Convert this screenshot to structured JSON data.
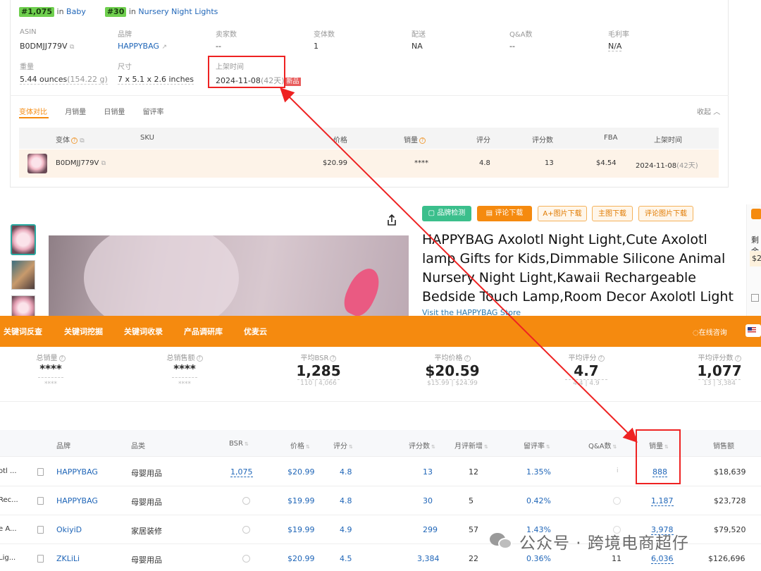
{
  "rank_bar": {
    "rank1": "#1,075",
    "in1": "in",
    "cat1": "Baby",
    "rank2": "#30",
    "in2": "in",
    "cat2": "Nursery Night Lights"
  },
  "product_info": {
    "asin_label": "ASIN",
    "asin": "B0DMJJ779V",
    "brand_label": "品牌",
    "brand": "HAPPYBAG",
    "seller_label": "卖家数",
    "seller": "--",
    "variant_label": "变体数",
    "variant": "1",
    "delivery_label": "配送",
    "delivery": "NA",
    "qa_label": "Q&A数",
    "qa": "--",
    "margin_label": "毛利率",
    "margin": "N/A",
    "weight_label": "重量",
    "weight": "5.44 ounces",
    "weight_g": "(154.22 g)",
    "size_label": "尺寸",
    "size": "7 x 5.1 x 2.6 inches",
    "listed_label": "上架时间",
    "listed": "2024-11-08",
    "listed_days": "(42天)",
    "new_badge": "新品"
  },
  "variant_tabs": {
    "tabs": [
      "变体对比",
      "月销量",
      "日销量",
      "留评率"
    ],
    "collapse": "收起"
  },
  "variant_table": {
    "headers": [
      "变体",
      "SKU",
      "价格",
      "销量",
      "评分",
      "评分数",
      "FBA",
      "上架时间"
    ],
    "row": {
      "asin": "B0DMJJ779V",
      "sku": "",
      "price": "$20.99",
      "sales": "****",
      "rating": "4.8",
      "reviews": "13",
      "fba": "$4.54",
      "listed": "2024-11-08",
      "days": "(42天)"
    }
  },
  "tool_buttons": [
    "品牌检测",
    "评论下载",
    "A+图片下载",
    "主图下载",
    "评论图片下载"
  ],
  "product_title": "HAPPYBAG Axolotl Night Light,Cute Axolotl lamp Gifts for Kids,Dimmable Silicone Animal Nursery Night Light,Kawaii Rechargeable Bedside Touch Lamp,Room Decor Axolotl Light",
  "store_link": "Visit the HAPPYBAG Store",
  "side_panel": {
    "t1": "剩余",
    "t2": "$2"
  },
  "orange_nav": {
    "items": [
      "关键词反查",
      "关键词挖掘",
      "关键词收录",
      "产品调研库",
      "优麦云"
    ],
    "online": "在线咨询"
  },
  "stats": [
    {
      "label": "总销量",
      "value": "****",
      "sub": "****"
    },
    {
      "label": "总销售额",
      "value": "****",
      "sub": "****"
    },
    {
      "label": "平均BSR",
      "value": "1,285",
      "sub_a": "110",
      "sub_b": "4,066"
    },
    {
      "label": "平均价格",
      "value": "$20.59",
      "sub_a": "$15.99",
      "sub_b": "$24.99"
    },
    {
      "label": "平均评分",
      "value": "4.7",
      "sub_a": "4.4",
      "sub_b": "4.9"
    },
    {
      "label": "平均评分数",
      "value": "1,077",
      "sub_a": "13",
      "sub_b": "3,384"
    }
  ],
  "table": {
    "headers": [
      "品牌",
      "品类",
      "BSR",
      "价格",
      "评分",
      "评分数",
      "月评新增",
      "留评率",
      "Q&A数",
      "销量",
      "销售额"
    ],
    "rows": [
      {
        "title": "otl ...",
        "brand": "HAPPYBAG",
        "category": "母婴用品",
        "bsr": "1,075",
        "price": "$20.99",
        "rating": "4.8",
        "reviews": "13",
        "new_reviews": "12",
        "review_rate": "1.35%",
        "qa": "",
        "sales": "888",
        "revenue": "$18,639"
      },
      {
        "title": "Rec...",
        "brand": "HAPPYBAG",
        "category": "母婴用品",
        "bsr": "",
        "price": "$19.99",
        "rating": "4.8",
        "reviews": "30",
        "new_reviews": "5",
        "review_rate": "0.42%",
        "qa": "",
        "sales": "1,187",
        "revenue": "$23,728"
      },
      {
        "title": "e A...",
        "brand": "OkiyiD",
        "category": "家居装修",
        "bsr": "",
        "price": "$19.99",
        "rating": "4.9",
        "reviews": "299",
        "new_reviews": "57",
        "review_rate": "1.43%",
        "qa": "",
        "sales": "3,978",
        "revenue": "$79,520"
      },
      {
        "title": "Lig...",
        "brand": "ZKLiLi",
        "category": "母婴用品",
        "bsr": "",
        "price": "$20.99",
        "rating": "4.5",
        "reviews": "3,384",
        "new_reviews": "22",
        "review_rate": "0.36%",
        "qa": "11",
        "sales": "6,036",
        "revenue": "$126,696"
      }
    ]
  },
  "watermark": "公众号 · 跨境电商超仔",
  "colors": {
    "orange": "#f58a0f",
    "link": "#2066b8",
    "annotation": "#ee2222",
    "rank_green": "#6fcf4e"
  }
}
